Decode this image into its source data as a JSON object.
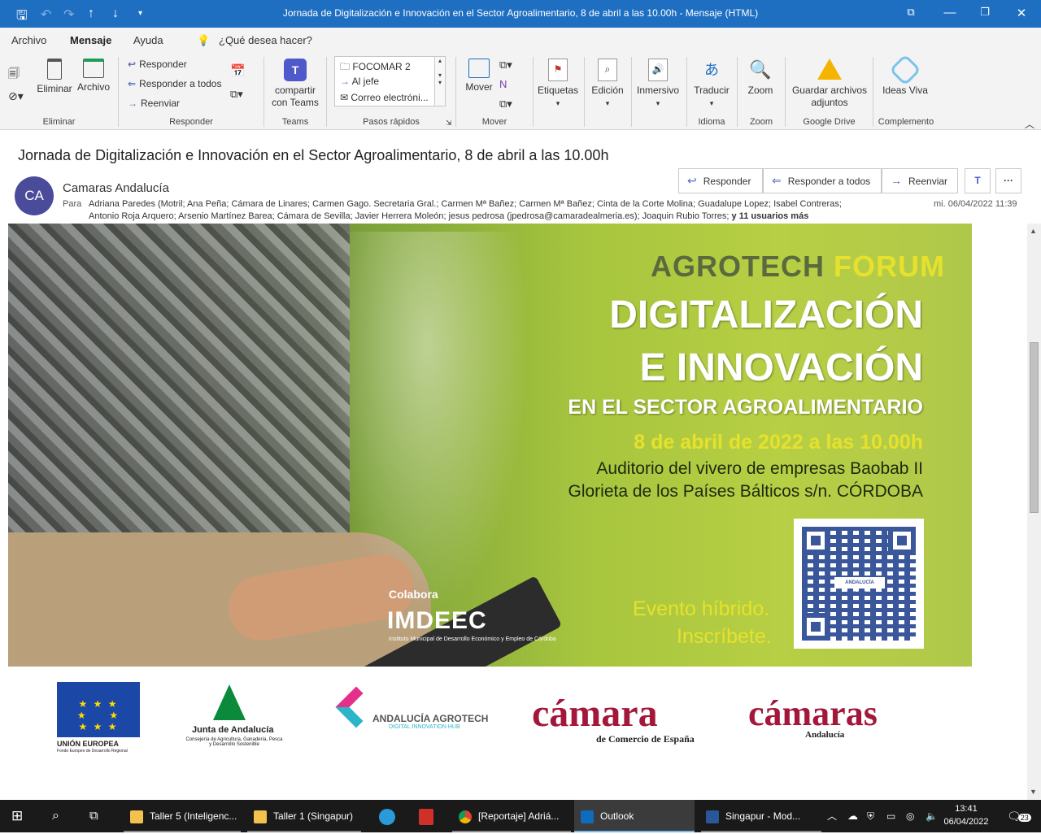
{
  "window": {
    "title": "Jornada de Digitalización e Innovación en el Sector Agroalimentario, 8 de abril a las 10.00h  -  Mensaje (HTML)"
  },
  "menu": {
    "tabs": [
      {
        "label": "Archivo"
      },
      {
        "label": "Mensaje",
        "active": true
      },
      {
        "label": "Ayuda"
      }
    ],
    "search_placeholder": "¿Qué desea hacer?"
  },
  "ribbon": {
    "eliminar": {
      "label": "Eliminar",
      "delete": "Eliminar",
      "archive": "Archivo"
    },
    "responder": {
      "label": "Responder",
      "reply": "Responder",
      "reply_all": "Responder a todos",
      "forward": "Reenviar"
    },
    "teams": {
      "label": "Teams",
      "share": "compartir con Teams"
    },
    "quick_steps": {
      "label": "Pasos rápidos",
      "items": [
        "FOCOMAR 2",
        "Al jefe",
        "Correo electróni..."
      ]
    },
    "mover": {
      "label": "Mover",
      "move": "Mover"
    },
    "etiquetas": {
      "label": "Etiquetas"
    },
    "edicion": {
      "label": "Edición"
    },
    "inmersivo": {
      "label": "Inmersivo"
    },
    "idioma": {
      "label": "Idioma",
      "translate": "Traducir"
    },
    "zoom": {
      "label": "Zoom",
      "zoom": "Zoom"
    },
    "gdrive": {
      "label": "Google Drive",
      "save": "Guardar archivos adjuntos"
    },
    "complemento": {
      "label": "Complemento",
      "ideas": "Ideas Viva"
    }
  },
  "message": {
    "subject": "Jornada de Digitalización e Innovación en el Sector Agroalimentario, 8 de abril a las 10.00h",
    "avatar_initials": "CA",
    "sender": "Camaras Andalucía",
    "to_label": "Para",
    "to_line1": "Adriana Paredes (Motril; Ana Peña; Cámara de Linares; Carmen Gago. Secretaria Gral.; Carmen Mª Bañez; Carmen Mª Bañez; Cinta de la Corte Molina; Guadalupe Lopez; Isabel Contreras;",
    "to_line2": "Antonio Roja Arquero; Arsenio Martínez Barea; Cámara de Sevilla; Javier Herrera Moleón; jesus pedrosa (jpedrosa@camaradealmeria.es); Joaquin Rubio Torres;",
    "to_more": "y 11 usuarios más",
    "date": "mi. 06/04/2022 11:39",
    "actions": {
      "reply": "Responder",
      "reply_all": "Responder a todos",
      "forward": "Reenviar"
    }
  },
  "banner": {
    "agrotech": "AGROTECH",
    "forum": "FORUM",
    "line1": "DIGITALIZACIÓN",
    "line2": "E INNOVACIÓN",
    "line3": "EN EL SECTOR AGROALIMENTARIO",
    "date": "8 de abril de 2022 a las 10.00h",
    "venue1": "Auditorio del vivero de empresas Baobab II",
    "venue2": "Glorieta de los Países Bálticos s/n. CÓRDOBA",
    "colabora": "Colabora",
    "imdeec": "IMDEEC",
    "imdeec_sub": "Instituto Municipal de Desarrollo Económico y Empleo de Córdoba",
    "event1": "Evento híbrido.",
    "event2": "Inscríbete.",
    "qr_caption": "ANDALUCÍA AGROTECH"
  },
  "logos": {
    "eu": "UNIÓN EUROPEA",
    "eu_sub": "Fondo Europeo de Desarrollo Regional",
    "junta": "Junta de Andalucía",
    "junta_sub": "Consejería de Agricultura, Ganadería, Pesca y Desarrollo Sostenible",
    "agrotech": "ANDALUCÍA AGROTECH",
    "agrotech_sub": "DIGITAL INNOVATION HUB",
    "camara": "cámara",
    "camara_sub": "de Comercio de España",
    "camaras": "cámaras",
    "camaras_sub": "Andalucía"
  },
  "taskbar": {
    "items": [
      {
        "label": "Taller 5 (Inteligenc..."
      },
      {
        "label": "Taller 1 (Singapur)"
      },
      {
        "label": "[Reportaje] Adriá..."
      },
      {
        "label": "Outlook"
      },
      {
        "label": "Singapur  -  Mod..."
      }
    ],
    "time": "13:41",
    "date": "06/04/2022",
    "notifications": "23"
  },
  "colors": {
    "accent": "#1e6fc1",
    "avatar": "#4b4b9b",
    "banner_yellow": "#e6e12c"
  }
}
